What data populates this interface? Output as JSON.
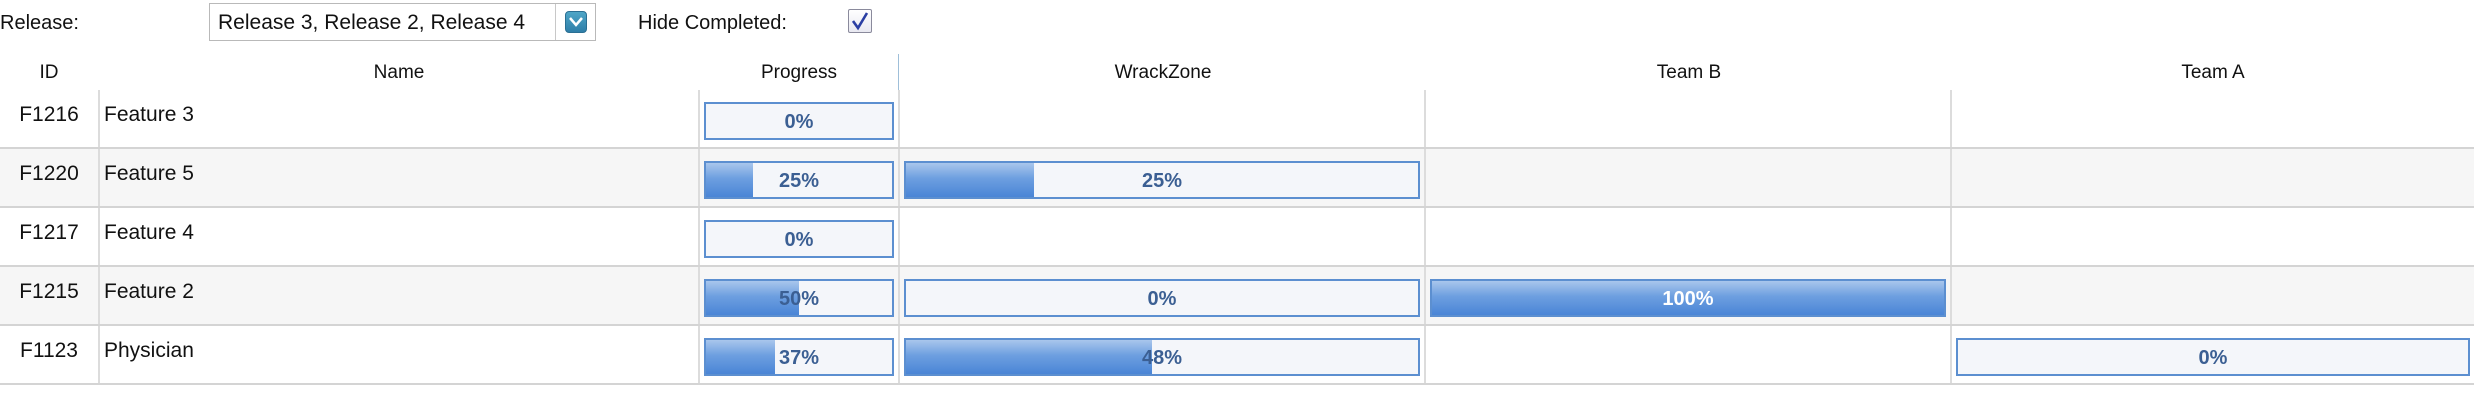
{
  "filters": {
    "release_label": "Release:",
    "release_value": "Release 3, Release 2, Release 4",
    "hide_completed_label": "Hide Completed:",
    "hide_completed_checked": true
  },
  "columns": [
    "ID",
    "Name",
    "Progress",
    "WrackZone",
    "Team B",
    "Team A"
  ],
  "rows": [
    {
      "id": "F1216",
      "name": "Feature 3",
      "progress": {
        "text": "0%",
        "value": 0
      }
    },
    {
      "id": "F1220",
      "name": "Feature 5",
      "progress": {
        "text": "25%",
        "value": 25
      },
      "wrackzone": {
        "text": "25%",
        "value": 25
      }
    },
    {
      "id": "F1217",
      "name": "Feature 4",
      "progress": {
        "text": "0%",
        "value": 0
      }
    },
    {
      "id": "F1215",
      "name": "Feature 2",
      "progress": {
        "text": "50%",
        "value": 50
      },
      "wrackzone": {
        "text": "0%",
        "value": 0
      },
      "team_b": {
        "text": "100%",
        "value": 100
      }
    },
    {
      "id": "F1123",
      "name": "Physician",
      "progress": {
        "text": "37%",
        "value": 37
      },
      "wrackzone": {
        "text": "48%",
        "value": 48
      },
      "team_a": {
        "text": "0%",
        "value": 0
      }
    }
  ],
  "colors": {
    "bar_border": "#5c8fd0",
    "bar_fill": "#4a85d6",
    "bar_text": "#3b5f93"
  }
}
